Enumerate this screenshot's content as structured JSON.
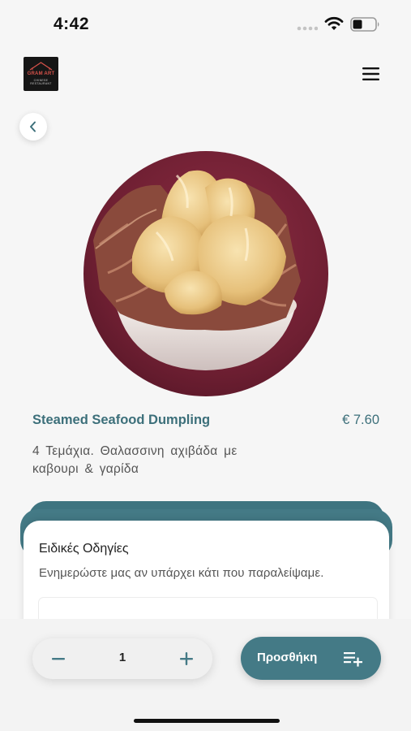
{
  "status_bar": {
    "time": "4:42"
  },
  "header": {
    "logo": {
      "name": "GRAM ART",
      "subtitle": "CHINESE RESTAURANT"
    }
  },
  "product": {
    "title": "Steamed Seafood Dumpling",
    "price": "€ 7.60",
    "description": "4 Τεμάχια. Θαλασσινη αχιβάδα με καβουρι & γαρίδα"
  },
  "special_instructions": {
    "title": "Ειδικές Οδηγίες",
    "hint": "Ενημερώστε μας αν υπάρχει κάτι που παραλείψαμε.",
    "value": ""
  },
  "cart": {
    "quantity": "1",
    "add_label": "Προσθήκη"
  },
  "colors": {
    "accent": "#447a86",
    "title_text": "#3c6f7a",
    "image_background": "#7a2337"
  },
  "icons": {
    "menu": "hamburger-menu-icon",
    "back": "chevron-left-icon",
    "minus": "minus-icon",
    "plus": "plus-icon",
    "add_to_list": "playlist-add-icon"
  }
}
